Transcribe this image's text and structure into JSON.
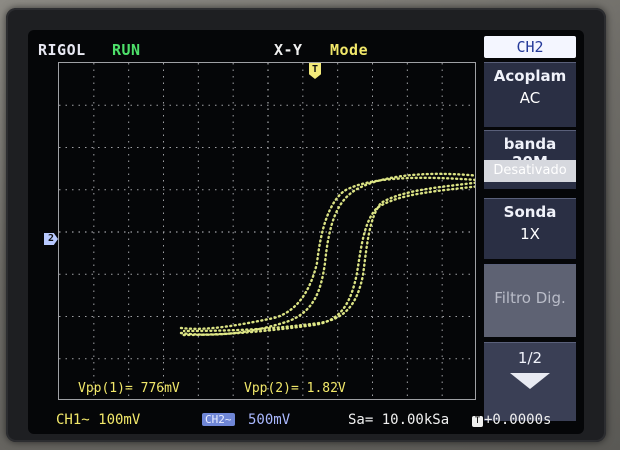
{
  "header": {
    "brand": "RIGOL",
    "run_state": "RUN",
    "mode_a": "X-Y",
    "mode_b": "Mode"
  },
  "markers": {
    "trigger": "T",
    "channel": "2"
  },
  "measurements": {
    "vpp1": "Vpp(1)= 776mV",
    "vpp2": "Vpp(2)= 1.82V"
  },
  "menu": {
    "title": "CH2",
    "items": [
      {
        "label": "Acoplam",
        "value": "AC"
      },
      {
        "label": "banda 20M",
        "value": "Desativado"
      },
      {
        "label": "Sonda",
        "value": "1X"
      },
      {
        "label": "Filtro Dig.",
        "value": ""
      },
      {
        "label": "1/2",
        "value": ""
      }
    ]
  },
  "status": {
    "ch1": "CH1~  100mV",
    "ch2_tag": "CH2~",
    "ch2_scale": "500mV",
    "sample_rate": "Sa= 10.00kSa",
    "trigger_offset": "+0.0000s",
    "trigger_icon": "T"
  },
  "colors": {
    "trace": "#e6ee8a",
    "ch1": "#f2e86a",
    "ch2": "#aab8ff",
    "run": "#4ee06a",
    "grid": "#9fa0a4"
  },
  "icons": {
    "menu_next": "arrow-down-icon"
  }
}
